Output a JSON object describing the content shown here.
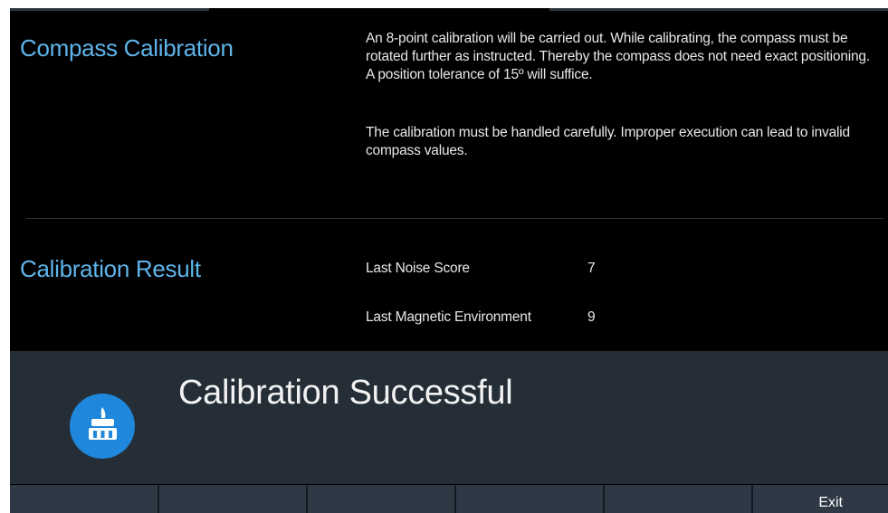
{
  "compass": {
    "title": "Compass Calibration",
    "paragraph1": "An 8-point calibration will be carried out. While calibrating, the compass must be rotated further as instructed. Thereby the compass does not need exact positioning. A position tolerance of 15º will suffice.",
    "paragraph2": "The calibration must be handled carefully. Improper execution can lead to invalid compass values."
  },
  "result": {
    "title": "Calibration Result",
    "rows": [
      {
        "label": "Last Noise Score",
        "value": "7"
      },
      {
        "label": "Last Magnetic Environment",
        "value": "9"
      }
    ]
  },
  "status": {
    "message": "Calibration Successful",
    "icon": "calibration-success-icon"
  },
  "softkeys": [
    "",
    "",
    "",
    "",
    "",
    "Exit"
  ],
  "colors": {
    "background": "#000000",
    "accent_title": "#5fb4ea",
    "status_panel": "#252e37",
    "icon_blue": "#1f88dc",
    "softkey": "#2e3945"
  }
}
